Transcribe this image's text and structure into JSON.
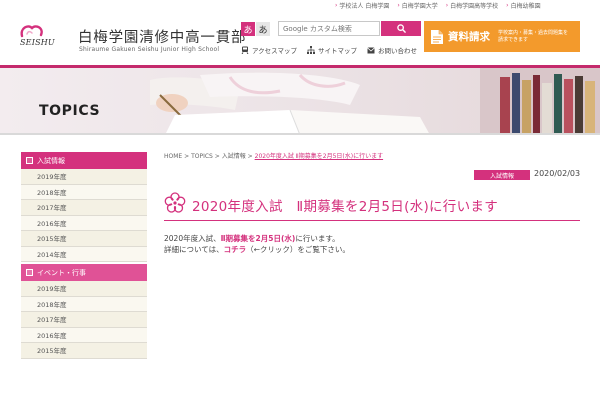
{
  "top_links": [
    {
      "label": "学校法人 白梅学園"
    },
    {
      "label": "白梅学園大学"
    },
    {
      "label": "白梅学園高等学校"
    },
    {
      "label": "白梅幼稚園"
    }
  ],
  "header": {
    "logo_text": "SEISHU",
    "school_name": "白梅学園清修中高一貫部",
    "school_name_en": "Shiraume Gakuen Seishu Junior High School",
    "font_small": "あ",
    "font_large": "あ",
    "search_placeholder": "Google カスタム検索",
    "util_links": [
      {
        "label": "アクセスマップ",
        "icon": "train-icon"
      },
      {
        "label": "サイトマップ",
        "icon": "sitemap-icon"
      },
      {
        "label": "お問い合わせ",
        "icon": "mail-icon"
      }
    ],
    "request_button": {
      "label": "資料請求",
      "sub": "学校案内・募集・過去問題集を請求できます"
    }
  },
  "banner": {
    "title": "TOPICS"
  },
  "sidebar": {
    "sections": [
      {
        "heading": "入試情報",
        "items": [
          "2019年度",
          "2018年度",
          "2017年度",
          "2016年度",
          "2015年度",
          "2014年度"
        ]
      },
      {
        "heading": "イベント・行事",
        "items": [
          "2019年度",
          "2018年度",
          "2017年度",
          "2016年度",
          "2015年度"
        ]
      }
    ]
  },
  "breadcrumb": {
    "home": "HOME",
    "sep": ">",
    "topics": "TOPICS",
    "category": "入試情報",
    "current": "2020年度入試 Ⅱ期募集を2月5日(水)に行います"
  },
  "post": {
    "category": "入試情報",
    "date": "2020/02/03",
    "title": "2020年度入試　Ⅱ期募集を2月5日(水)に行います",
    "line1_pre": "2020年度入試、",
    "line1_em": "Ⅱ期募集を2月5日(水)",
    "line1_post": "に行います。",
    "line2_pre": "詳細については、",
    "line2_link": "コチラ",
    "line2_post": "（←クリック）をご覧下さい。"
  },
  "colors": {
    "brand": "#d4317d",
    "request": "#f39a2c",
    "banner_stripe": "#c42a6c"
  }
}
